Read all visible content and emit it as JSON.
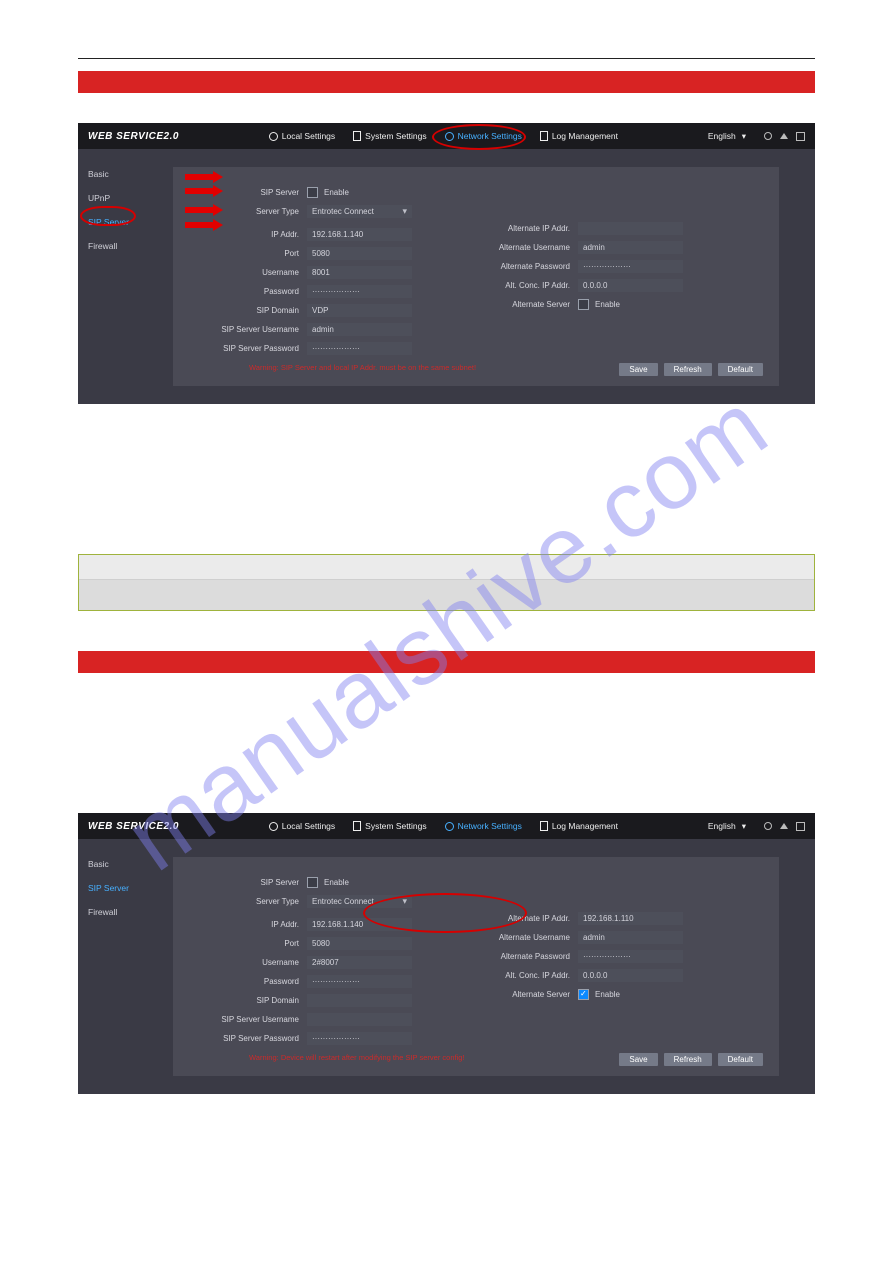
{
  "watermark": "manualshive.com",
  "ws": {
    "brand": "WEB SERVICE2.0",
    "nav": {
      "local": "Local Settings",
      "system": "System Settings",
      "network": "Network Settings",
      "log": "Log Management"
    },
    "lang": "English",
    "sidebar1": {
      "basic": "Basic",
      "upnp": "UPnP",
      "sip": "SIP Server",
      "firewall": "Firewall"
    },
    "sidebar2": {
      "basic": "Basic",
      "sip": "SIP Server",
      "firewall": "Firewall"
    }
  },
  "form1": {
    "labels": {
      "sipServer": "SIP Server",
      "serverType": "Server Type",
      "ipAddr": "IP Addr.",
      "port": "Port",
      "username": "Username",
      "password": "Password",
      "sipDomain": "SIP Domain",
      "sipSrvUser": "SIP Server Username",
      "sipSrvPass": "SIP Server Password",
      "altIp": "Alternate IP Addr.",
      "altUser": "Alternate Username",
      "altPass": "Alternate Password",
      "altConc": "Alt. Conc. IP Addr.",
      "altServer": "Alternate Server"
    },
    "values": {
      "enable": "Enable",
      "serverType": "Entrotec Connect",
      "ipAddr": "192.168.1.140",
      "port": "5080",
      "username": "8001",
      "password": "··················",
      "sipDomain": "VDP",
      "sipSrvUser": "admin",
      "sipSrvPass": "··················",
      "altIp": "",
      "altUser": "admin",
      "altPass": "··················",
      "altConc": "0.0.0.0",
      "altServer": "Enable"
    },
    "warning": "Warning: SIP Server and local IP Addr. must be on the same subnet!",
    "buttons": {
      "save": "Save",
      "refresh": "Refresh",
      "default": "Default"
    }
  },
  "form2": {
    "values": {
      "enable": "Enable",
      "serverType": "Entrotec Connect",
      "ipAddr": "192.168.1.140",
      "port": "5080",
      "username": "2#8007",
      "password": "··················",
      "sipDomain": "",
      "sipSrvUser": "",
      "sipSrvPass": "··················",
      "altIp": "192.168.1.110",
      "altUser": "admin",
      "altPass": "··················",
      "altConc": "0.0.0.0",
      "altServer": "Enable"
    },
    "warning": "Warning: Device will restart after modifying the SIP server config!"
  }
}
